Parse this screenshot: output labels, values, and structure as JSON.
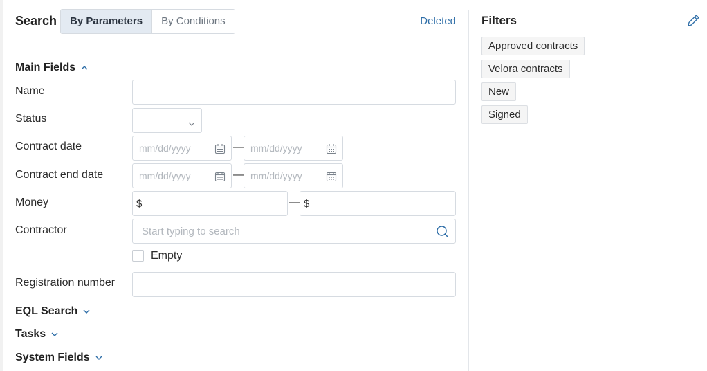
{
  "header": {
    "title": "Search",
    "tabs": [
      {
        "label": "By Parameters",
        "active": true
      },
      {
        "label": "By Conditions",
        "active": false
      }
    ],
    "deleted_link": "Deleted"
  },
  "sections": {
    "main_fields": {
      "label": "Main Fields",
      "expanded": true
    },
    "eql_search": {
      "label": "EQL Search",
      "expanded": false
    },
    "tasks": {
      "label": "Tasks",
      "expanded": false
    },
    "system_fields": {
      "label": "System Fields",
      "expanded": false
    }
  },
  "form": {
    "name": {
      "label": "Name",
      "value": ""
    },
    "status": {
      "label": "Status",
      "value": ""
    },
    "contract_date": {
      "label": "Contract date",
      "from_placeholder": "mm/dd/yyyy",
      "to_placeholder": "mm/dd/yyyy"
    },
    "contract_end_date": {
      "label": "Contract end date",
      "from_placeholder": "mm/dd/yyyy",
      "to_placeholder": "mm/dd/yyyy"
    },
    "money": {
      "label": "Money",
      "from_prefix": "$",
      "to_prefix": "$"
    },
    "contractor": {
      "label": "Contractor",
      "placeholder": "Start typing to search",
      "empty_label": "Empty"
    },
    "registration_number": {
      "label": "Registration number",
      "value": ""
    },
    "range_separator": "—"
  },
  "filters": {
    "title": "Filters",
    "items": [
      "Approved contracts",
      "Velora contracts",
      "New",
      "Signed"
    ]
  },
  "colors": {
    "accent": "#2d6da7",
    "active_tab_bg": "#e3eaf2",
    "border": "#d6dbe1"
  },
  "icons": {
    "calendar": "calendar-icon",
    "search": "search-icon",
    "chevron": "chevron-icon",
    "edit": "pencil-icon"
  }
}
